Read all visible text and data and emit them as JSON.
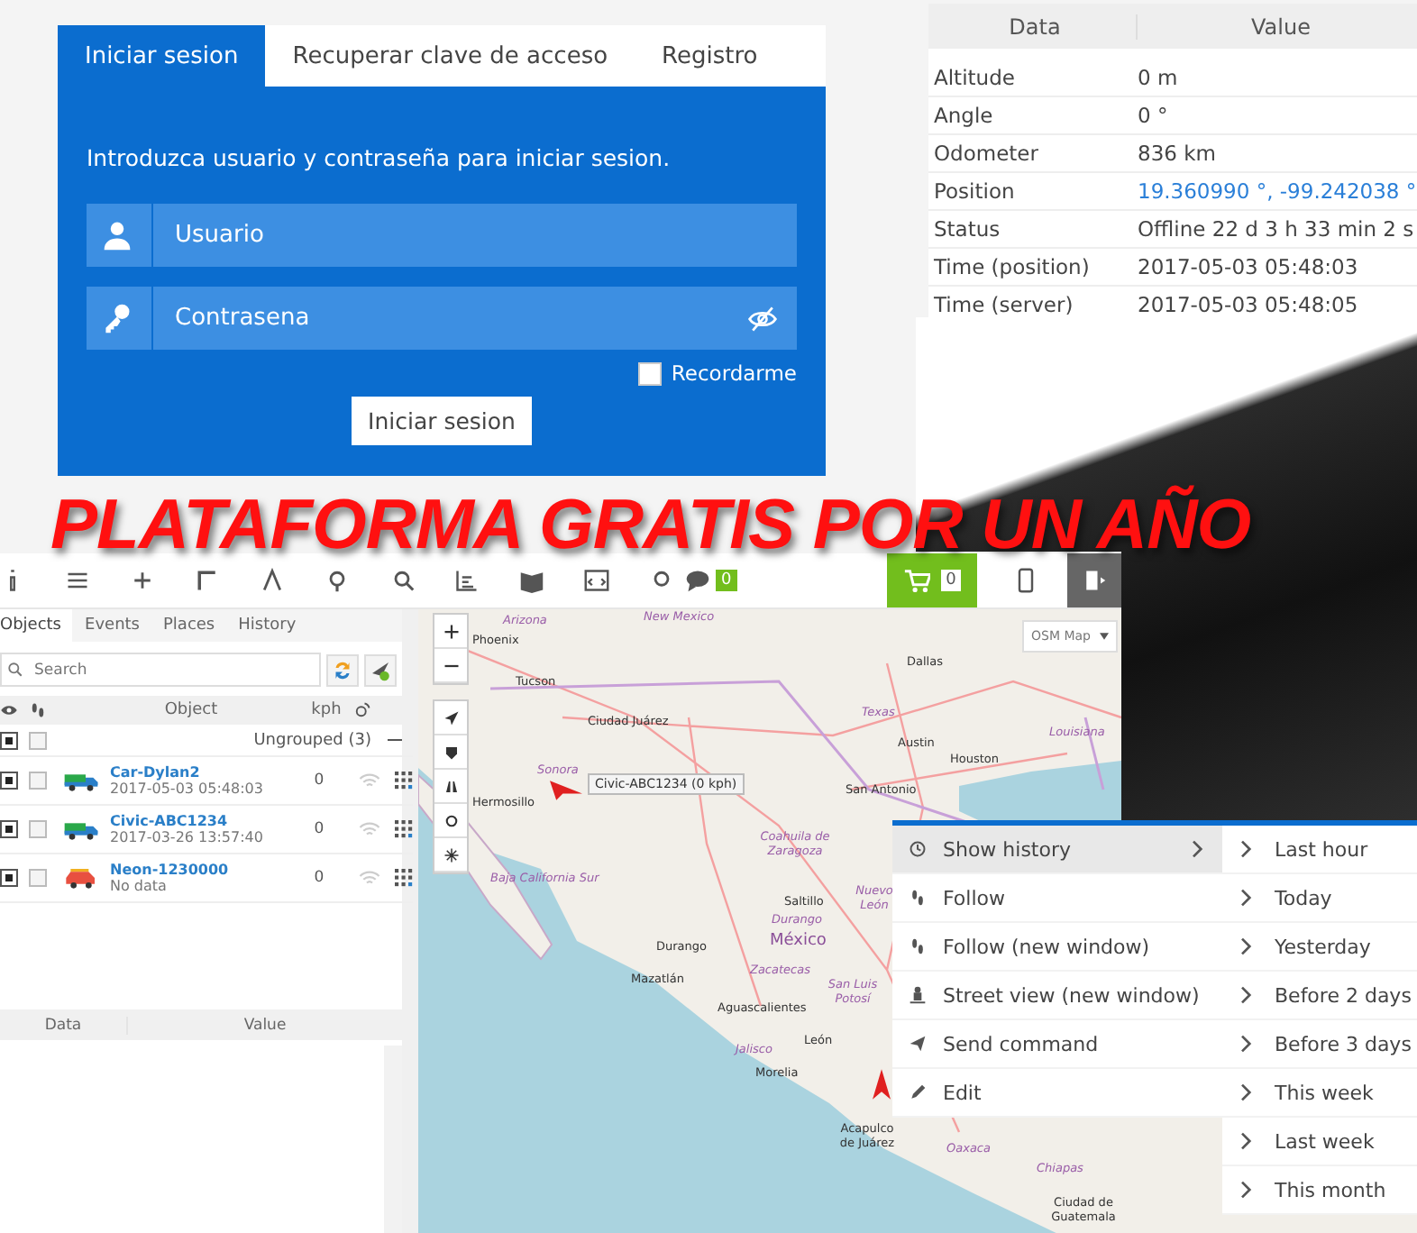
{
  "login": {
    "tabs": [
      {
        "label": "Iniciar sesion",
        "selected": true
      },
      {
        "label": "Recuperar clave de acceso",
        "selected": false
      },
      {
        "label": "Registro",
        "selected": false
      }
    ],
    "prompt": "Introduzca usuario y contraseña para iniciar sesion.",
    "username": {
      "placeholder": "Usuario"
    },
    "password": {
      "placeholder": "Contrasena"
    },
    "remember": {
      "label": "Recordarme",
      "checked": false
    },
    "submit": "Iniciar sesion"
  },
  "data_table": {
    "columns": [
      "Data",
      "Value"
    ],
    "rows": [
      {
        "data": "Altitude",
        "value": "0 m",
        "kind": "text"
      },
      {
        "data": "Angle",
        "value": "0 °",
        "kind": "text"
      },
      {
        "data": "Odometer",
        "value": "836 km",
        "kind": "text"
      },
      {
        "data": "Position",
        "value": "19.360990 °, -99.242038 °",
        "kind": "link"
      },
      {
        "data": "Status",
        "value": "Offline 22 d 3 h 33 min 2 s",
        "kind": "text"
      },
      {
        "data": "Time (position)",
        "value": "2017-05-03 05:48:03",
        "kind": "text"
      },
      {
        "data": "Time (server)",
        "value": "2017-05-03 05:48:05",
        "kind": "text"
      }
    ]
  },
  "banner": "PLATAFORMA GRATIS POR UN AÑO",
  "toolbar": {
    "messages_count": "0",
    "cart_count": "0"
  },
  "side_tabs": [
    {
      "label": "Objects",
      "selected": true
    },
    {
      "label": "Events",
      "selected": false
    },
    {
      "label": "Places",
      "selected": false
    },
    {
      "label": "History",
      "selected": false
    }
  ],
  "search": {
    "placeholder": "Search"
  },
  "objects_table": {
    "columns": [
      "Object",
      "kph"
    ],
    "group": {
      "label": "Ungrouped (3)",
      "visible": true,
      "followed": false
    },
    "rows": [
      {
        "name": "Car-Dylan2",
        "time": "2017-05-03 05:48:03",
        "speed": "0",
        "kind": "truck",
        "visible": true,
        "followed": false
      },
      {
        "name": "Civic-ABC1234",
        "time": "2017-03-26 13:57:40",
        "speed": "0",
        "kind": "truck",
        "visible": true,
        "followed": false
      },
      {
        "name": "Neon-1230000",
        "time": "No data",
        "speed": "0",
        "kind": "car",
        "visible": true,
        "followed": false
      }
    ]
  },
  "details_table": {
    "columns": [
      "Data",
      "Value"
    ]
  },
  "map": {
    "type_select": "OSM Map",
    "marker_label": "Civic-ABC1234 (0 kph)",
    "labels": [
      {
        "text": "Arizona",
        "kind": "region"
      },
      {
        "text": "New Mexico",
        "kind": "region"
      },
      {
        "text": "Phoenix",
        "kind": "city"
      },
      {
        "text": "Tucson",
        "kind": "city"
      },
      {
        "text": "Dallas",
        "kind": "city"
      },
      {
        "text": "Ciudad Juárez",
        "kind": "city"
      },
      {
        "text": "Texas",
        "kind": "region"
      },
      {
        "text": "Austin",
        "kind": "city"
      },
      {
        "text": "Houston",
        "kind": "city"
      },
      {
        "text": "San Antonio",
        "kind": "city"
      },
      {
        "text": "Louisiana",
        "kind": "region"
      },
      {
        "text": "Sonora",
        "kind": "region"
      },
      {
        "text": "Hermosillo",
        "kind": "city"
      },
      {
        "text": "Coahuila de Zaragoza",
        "kind": "region"
      },
      {
        "text": "Saltillo",
        "kind": "city"
      },
      {
        "text": "Nuevo León",
        "kind": "region"
      },
      {
        "text": "Baja California Sur",
        "kind": "region"
      },
      {
        "text": "Durango",
        "kind": "region"
      },
      {
        "text": "Durango",
        "kind": "city"
      },
      {
        "text": "México",
        "kind": "country"
      },
      {
        "text": "Zacatecas",
        "kind": "region"
      },
      {
        "text": "Mazatlán",
        "kind": "city"
      },
      {
        "text": "San Luis Potosí",
        "kind": "region"
      },
      {
        "text": "Aguascalientes",
        "kind": "city"
      },
      {
        "text": "León",
        "kind": "city"
      },
      {
        "text": "Jalisco",
        "kind": "region"
      },
      {
        "text": "Morelia",
        "kind": "city"
      },
      {
        "text": "Acapulco de Juárez",
        "kind": "city"
      },
      {
        "text": "Oaxaca",
        "kind": "region"
      },
      {
        "text": "Chiapas",
        "kind": "region"
      },
      {
        "text": "Ciudad de Guatemala",
        "kind": "city"
      }
    ]
  },
  "context_menu": {
    "items": [
      {
        "label": "Show history",
        "kind": "history",
        "selected": true,
        "submenu": true
      },
      {
        "label": "Follow",
        "kind": "follow",
        "selected": false,
        "submenu": false
      },
      {
        "label": "Follow (new window)",
        "kind": "follow",
        "selected": false,
        "submenu": false
      },
      {
        "label": "Street view (new window)",
        "kind": "street",
        "selected": false,
        "submenu": false
      },
      {
        "label": "Send command",
        "kind": "send",
        "selected": false,
        "submenu": false
      },
      {
        "label": "Edit",
        "kind": "edit",
        "selected": false,
        "submenu": false
      }
    ],
    "submenu": [
      "Last hour",
      "Today",
      "Yesterday",
      "Before 2 days",
      "Before 3 days",
      "This week",
      "Last week",
      "This month"
    ]
  }
}
